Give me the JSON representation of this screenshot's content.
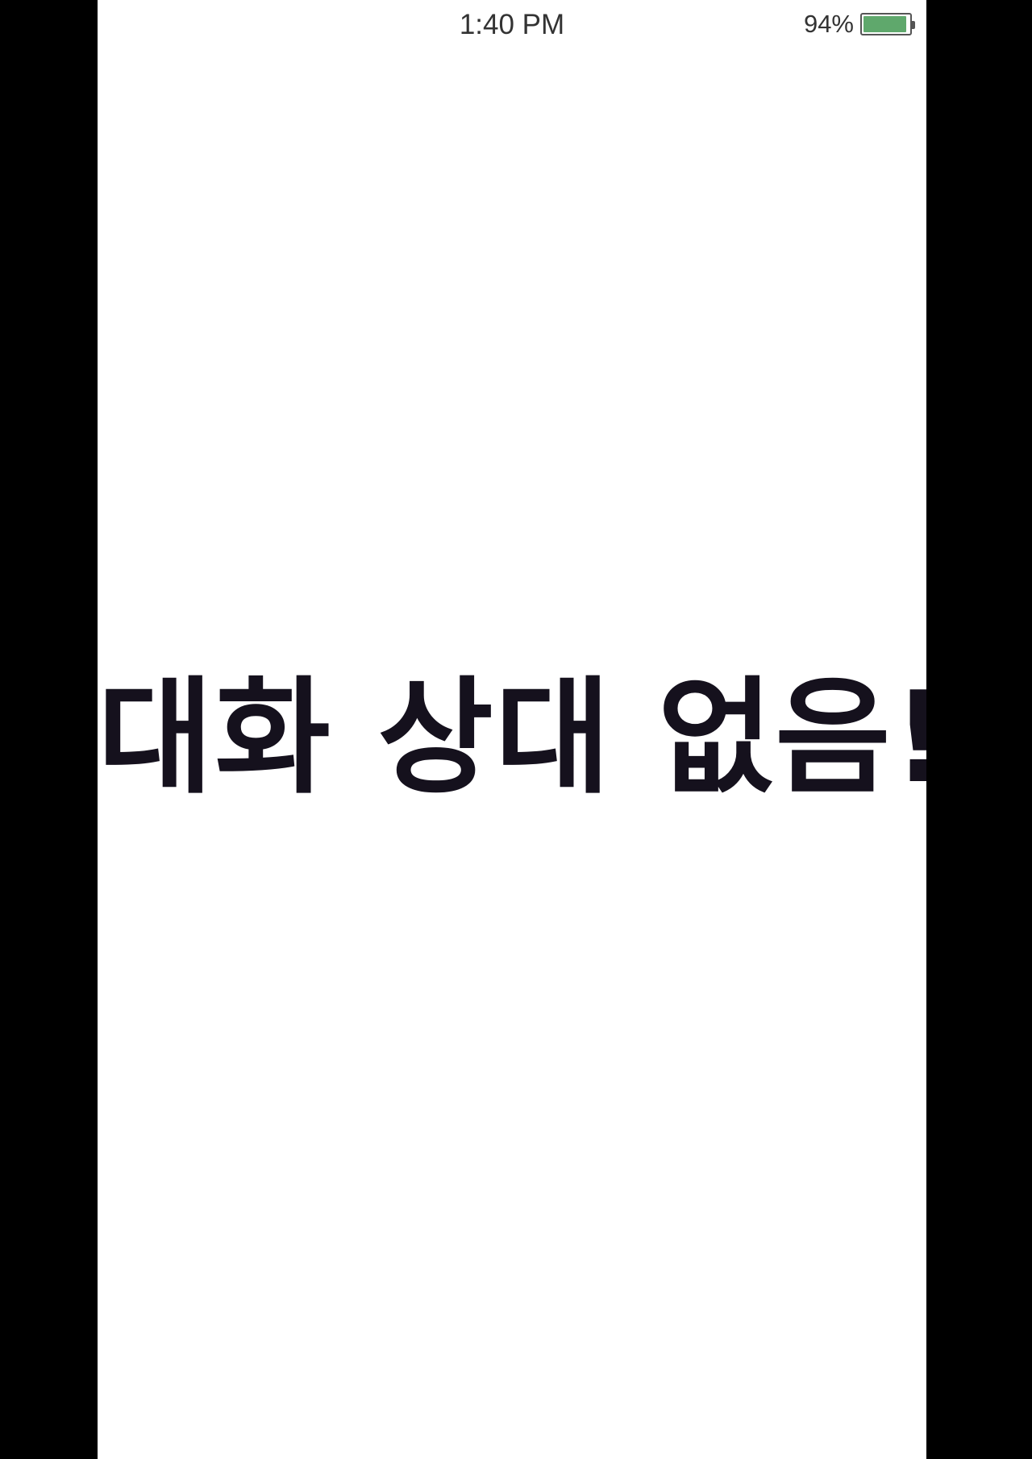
{
  "status_bar": {
    "time": "1:40 PM",
    "battery_text": "94%",
    "battery_level": 0.94,
    "battery_color": "#5fa86c"
  },
  "main": {
    "empty_message": "대화 상대 없음!"
  },
  "colors": {
    "background": "#ffffff",
    "frame": "#000000",
    "text": "#15111d"
  }
}
